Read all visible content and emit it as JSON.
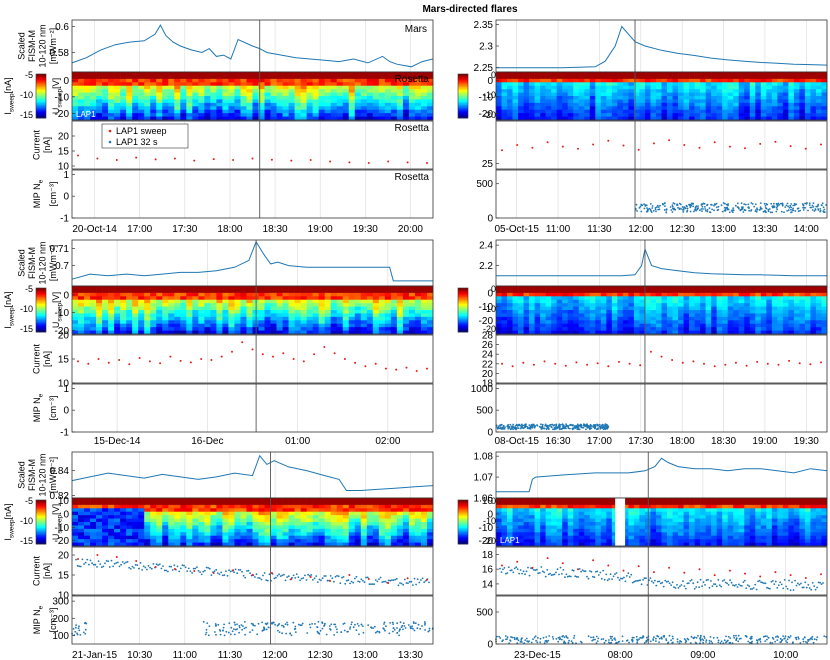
{
  "title": "Mars-directed flares",
  "colors": {
    "line": "#1f77b4",
    "sweep": "#e0201b",
    "lap32": "#1f77b4",
    "grid": "#d9d9d9",
    "flare": "#555555"
  },
  "labels": {
    "fism": [
      "Scaled",
      "FISM-M",
      "10-120 nm",
      "[mWm⁻²]"
    ],
    "isweep": "I",
    "isweep_sub": "sweep",
    "isweep_unit": "[nA]",
    "usweep": "U",
    "usweep_sub": "sweep",
    "usweep_unit": "[V]",
    "current": [
      "Current",
      "[nA]"
    ],
    "mip": [
      "MIP N",
      "[cm⁻³]"
    ],
    "mip_sub": "e"
  },
  "panel_tags": {
    "mars": "Mars",
    "rosetta": "Rosetta",
    "lap1": "LAP1"
  },
  "legend": {
    "sweep": "LAP1 sweep",
    "lap32": "LAP1 32 s"
  },
  "chart_data": [
    {
      "id": "c1",
      "type": "line",
      "flare_time": "17:58",
      "xticks": [
        "20-Oct-14",
        "17:00",
        "17:30",
        "18:00",
        "18:30",
        "19:00",
        "19:30",
        "20:00"
      ],
      "tags": {
        "fism": "mars",
        "spec": "rosetta",
        "spec_lap1": true,
        "cur": "rosetta",
        "mip": "rosetta",
        "legend": true
      },
      "fism": {
        "ylim": [
          0.565,
          0.605
        ],
        "yticks": [
          "0.6",
          "0.58"
        ],
        "ytick_vals": [
          0.6,
          0.58
        ],
        "x": [
          0,
          0.04,
          0.08,
          0.12,
          0.16,
          0.2,
          0.23,
          0.245,
          0.26,
          0.28,
          0.3,
          0.33,
          0.36,
          0.38,
          0.4,
          0.42,
          0.44,
          0.46,
          0.5,
          0.52,
          0.54,
          0.58,
          0.62,
          0.66,
          0.7,
          0.74,
          0.78,
          0.82,
          0.86,
          0.88,
          0.9,
          0.94,
          0.97,
          1
        ],
        "y": [
          0.572,
          0.576,
          0.582,
          0.586,
          0.588,
          0.589,
          0.594,
          0.601,
          0.593,
          0.588,
          0.585,
          0.582,
          0.58,
          0.583,
          0.577,
          0.578,
          0.575,
          0.59,
          0.585,
          0.583,
          0.58,
          0.578,
          0.576,
          0.575,
          0.574,
          0.573,
          0.575,
          0.572,
          0.577,
          0.573,
          0.571,
          0.569,
          0.573,
          0.575
        ]
      },
      "spec": {
        "cbar": false,
        "yticks": [
          "0",
          "-10",
          "-20"
        ],
        "ytick_vals": [
          0,
          -10,
          -20
        ],
        "ylim": [
          -24,
          5
        ],
        "gap": null
      },
      "current": {
        "ylim": [
          9,
          25
        ],
        "yticks": [
          "20",
          "15",
          "10"
        ],
        "ytick_vals": [
          20,
          15,
          10
        ],
        "sweep": [
          13.5,
          12.5,
          12.0,
          12.8,
          12.2,
          12.5,
          11.8,
          12.3,
          12.0,
          12.5,
          12.1,
          11.8,
          12.0,
          11.5,
          11.2,
          11.0,
          11.5,
          11.2,
          11.0
        ],
        "lap32": null
      },
      "mip": {
        "ylim": [
          -1,
          1.2
        ],
        "yticks": [
          "1",
          "0",
          "-1"
        ],
        "ytick_vals": [
          1,
          0,
          -1
        ],
        "points": null
      }
    },
    {
      "id": "c2",
      "type": "line",
      "flare_time": "11:40",
      "xticks": [
        "05-Oct-15",
        "11:00",
        "11:30",
        "12:00",
        "12:30",
        "13:00",
        "13:30",
        "14:00"
      ],
      "tags": {
        "fism": null,
        "spec": null,
        "spec_lap1": false,
        "cur": null,
        "mip": null,
        "legend": false
      },
      "fism": {
        "ylim": [
          2.24,
          2.36
        ],
        "yticks": [
          "2.35",
          "2.3",
          "2.25"
        ],
        "ytick_vals": [
          2.35,
          2.3,
          2.25
        ],
        "x": [
          0,
          0.1,
          0.2,
          0.3,
          0.33,
          0.36,
          0.38,
          0.42,
          0.45,
          0.5,
          0.55,
          0.6,
          0.65,
          0.7,
          0.75,
          0.8,
          0.85,
          0.9,
          0.95,
          1
        ],
        "y": [
          2.25,
          2.25,
          2.25,
          2.252,
          2.265,
          2.3,
          2.345,
          2.31,
          2.3,
          2.29,
          2.283,
          2.278,
          2.272,
          2.268,
          2.265,
          2.262,
          2.26,
          2.258,
          2.257,
          2.256
        ]
      },
      "spec": {
        "cbar": true,
        "yticks": [
          "0",
          "-10",
          "-20"
        ],
        "ytick_vals": [
          0,
          -10,
          -20
        ],
        "ylim": [
          -24,
          5
        ],
        "gap": null
      },
      "current": {
        "ylim": [
          24,
          33
        ],
        "yticks": [
          "25"
        ],
        "ytick_vals": [
          25
        ],
        "sweep": [
          27.5,
          28.5,
          28.0,
          29.0,
          28.2,
          27.8,
          28.6,
          29.3,
          28.4,
          27.6,
          28.8,
          29.4,
          28.5,
          28.0,
          29.0,
          28.2,
          27.9,
          28.7,
          29.1,
          28.3,
          27.8,
          28.6
        ],
        "lap32": null
      },
      "mip": {
        "ylim": [
          0,
          700
        ],
        "yticks": [
          "500",
          "0"
        ],
        "ytick_vals": [
          500,
          0
        ],
        "points": {
          "xstart": 0.42,
          "xend": 1,
          "mean": 150,
          "spread": 70
        }
      }
    },
    {
      "id": "c3",
      "type": "line",
      "flare_time": "00:00",
      "xticks": [
        "15-Dec-14",
        "16-Dec",
        "01:00",
        "02:00"
      ],
      "tags": {
        "fism": null,
        "spec": null,
        "spec_lap1": false,
        "cur": null,
        "mip": null,
        "legend": false
      },
      "fism": {
        "ylim": [
          0.688,
          0.715
        ],
        "yticks": [
          "0.71",
          "0.7"
        ],
        "ytick_vals": [
          0.71,
          0.7
        ],
        "x": [
          0,
          0.05,
          0.1,
          0.15,
          0.2,
          0.25,
          0.3,
          0.35,
          0.4,
          0.45,
          0.49,
          0.51,
          0.53,
          0.55,
          0.57,
          0.6,
          0.65,
          0.7,
          0.75,
          0.8,
          0.85,
          0.88,
          0.89,
          0.95,
          1
        ],
        "y": [
          0.692,
          0.695,
          0.694,
          0.695,
          0.694,
          0.695,
          0.696,
          0.696,
          0.697,
          0.699,
          0.703,
          0.714,
          0.707,
          0.701,
          0.702,
          0.7,
          0.699,
          0.699,
          0.699,
          0.699,
          0.699,
          0.699,
          0.691,
          0.691,
          0.691
        ]
      },
      "spec": {
        "cbar": true,
        "yticks": [
          "0",
          "-10",
          "-20"
        ],
        "ytick_vals": [
          0,
          -10,
          -20
        ],
        "ylim": [
          -22,
          5
        ],
        "gap": null
      },
      "current": {
        "ylim": [
          10,
          20
        ],
        "yticks": [
          "20",
          "15",
          "10"
        ],
        "ytick_vals": [
          20,
          15,
          10
        ],
        "sweep": [
          14.5,
          14.0,
          15.0,
          14.2,
          14.8,
          13.9,
          15.2,
          14.5,
          14.1,
          15.5,
          14.6,
          14.3,
          15.0,
          14.8,
          15.5,
          16.5,
          18.5,
          17.0,
          16.0,
          15.5,
          16.2,
          15.0,
          14.5,
          16.0,
          17.5,
          16.2,
          15.0,
          14.2,
          13.5,
          14.0,
          13.0,
          12.8,
          13.2,
          12.5,
          13.0
        ],
        "lap32": null
      },
      "mip": {
        "ylim": [
          -1,
          1.2
        ],
        "yticks": [
          "1",
          "0",
          "-1"
        ],
        "ytick_vals": [
          1,
          0,
          -1
        ],
        "points": null
      }
    },
    {
      "id": "c4",
      "type": "line",
      "flare_time": "17:20",
      "xticks": [
        "08-Oct-15",
        "16:30",
        "17:00",
        "17:30",
        "18:00",
        "18:30",
        "19:00",
        "19:30"
      ],
      "tags": {
        "fism": null,
        "spec": null,
        "spec_lap1": false,
        "cur": null,
        "mip": null,
        "legend": false
      },
      "fism": {
        "ylim": [
          2.0,
          2.45
        ],
        "yticks": [
          "2.4",
          "2.2"
        ],
        "ytick_vals": [
          2.4,
          2.2
        ],
        "x": [
          0,
          0.1,
          0.2,
          0.3,
          0.38,
          0.42,
          0.44,
          0.45,
          0.47,
          0.5,
          0.55,
          0.6,
          0.65,
          0.7,
          0.75,
          0.8,
          0.85,
          0.9,
          0.95,
          1
        ],
        "y": [
          2.1,
          2.1,
          2.1,
          2.1,
          2.1,
          2.11,
          2.2,
          2.36,
          2.2,
          2.17,
          2.15,
          2.13,
          2.12,
          2.115,
          2.11,
          2.11,
          2.105,
          2.1,
          2.1,
          2.1
        ]
      },
      "spec": {
        "cbar": true,
        "yticks": [
          "0",
          "-10",
          "-20"
        ],
        "ytick_vals": [
          0,
          -10,
          -20
        ],
        "ylim": [
          -30,
          5
        ],
        "gap": null
      },
      "current": {
        "ylim": [
          18,
          28
        ],
        "yticks": [
          "28",
          "26",
          "24",
          "22",
          "20",
          "18"
        ],
        "ytick_vals": [
          28,
          26,
          24,
          22,
          20,
          18
        ],
        "sweep": [
          22.0,
          21.5,
          22.2,
          21.8,
          22.5,
          22.0,
          21.6,
          22.3,
          21.8,
          22.1,
          21.5,
          22.4,
          22.0,
          21.7,
          24.5,
          23.5,
          22.8,
          22.2,
          22.5,
          22.0,
          21.5,
          21.8,
          22.2,
          21.6,
          22.4,
          22.0,
          21.8,
          22.6,
          22.1,
          21.9,
          22.3
        ],
        "lap32": null
      },
      "mip": {
        "ylim": [
          0,
          1100
        ],
        "yticks": [
          "1000",
          "500",
          "0"
        ],
        "ytick_vals": [
          1000,
          500,
          0
        ],
        "points": {
          "xstart": 0,
          "xend": 0.34,
          "mean": 120,
          "spread": 60
        }
      }
    },
    {
      "id": "c5",
      "type": "line",
      "flare_time": "11:35",
      "xticks": [
        "21-Jan-15",
        "10:30",
        "11:00",
        "11:30",
        "12:00",
        "12:30",
        "13:00",
        "13:30"
      ],
      "tags": {
        "fism": null,
        "spec": null,
        "spec_lap1": false,
        "cur": null,
        "mip": null,
        "legend": false
      },
      "fism": {
        "ylim": [
          0.818,
          0.855
        ],
        "yticks": [
          "0.84",
          "0.82"
        ],
        "ytick_vals": [
          0.84,
          0.82
        ],
        "x": [
          0,
          0.05,
          0.1,
          0.15,
          0.2,
          0.25,
          0.3,
          0.35,
          0.4,
          0.45,
          0.5,
          0.52,
          0.54,
          0.56,
          0.6,
          0.65,
          0.7,
          0.74,
          0.76,
          0.8,
          0.85,
          0.9,
          0.95,
          1
        ],
        "y": [
          0.832,
          0.835,
          0.838,
          0.836,
          0.834,
          0.837,
          0.835,
          0.833,
          0.835,
          0.838,
          0.836,
          0.852,
          0.845,
          0.848,
          0.843,
          0.84,
          0.836,
          0.833,
          0.824,
          0.824,
          0.825,
          0.826,
          0.827,
          0.828
        ]
      },
      "spec": {
        "cbar": false,
        "yticks": [
          "10",
          "0",
          "-10",
          "-20"
        ],
        "ytick_vals": [
          10,
          0,
          -10,
          -20
        ],
        "ylim": [
          -24,
          12
        ],
        "gap": null
      },
      "current": {
        "ylim": [
          10,
          22
        ],
        "yticks": [
          "20",
          "15",
          "10"
        ],
        "ytick_vals": [
          20,
          15,
          10
        ],
        "sweep": [
          19.0,
          20.0,
          19.5,
          18.5,
          17.0,
          16.5,
          16.0,
          15.5,
          16.2,
          15.0,
          15.5,
          14.0,
          14.5,
          13.5,
          15.0,
          14.0,
          13.0,
          14.2,
          13.8
        ],
        "lap32": {
          "trend": [
            [
              0,
              18
            ],
            [
              0.15,
              17.5
            ],
            [
              0.3,
              16.5
            ],
            [
              0.45,
              15.5
            ],
            [
              0.55,
              14.5
            ],
            [
              0.7,
              14.0
            ],
            [
              0.85,
              13.5
            ],
            [
              1,
              13.2
            ]
          ],
          "spread": 1.0
        }
      },
      "mip": {
        "ylim": [
          50,
          330
        ],
        "yticks": [
          "300",
          "200",
          "100"
        ],
        "ytick_vals": [
          300,
          200,
          100
        ],
        "points": {
          "xstart": 0,
          "xend": 1,
          "mean": 140,
          "spread": 40,
          "gapstart": 0.04,
          "gapend": 0.36
        }
      }
    },
    {
      "id": "c6",
      "type": "line",
      "flare_time": "08:05",
      "xticks": [
        "23-Dec-15",
        "08:00",
        "09:00",
        "10:00"
      ],
      "tags": {
        "fism": null,
        "spec": null,
        "spec_lap1": true,
        "cur": null,
        "mip": null,
        "legend": false
      },
      "fism": {
        "ylim": [
          1.06,
          1.082
        ],
        "yticks": [
          "1.08",
          "1.07",
          "1.06"
        ],
        "ytick_vals": [
          1.08,
          1.07,
          1.06
        ],
        "x": [
          0,
          0.05,
          0.1,
          0.11,
          0.12,
          0.2,
          0.3,
          0.4,
          0.45,
          0.48,
          0.5,
          0.52,
          0.55,
          0.6,
          0.65,
          0.7,
          0.75,
          0.8,
          0.85,
          0.9,
          0.95,
          1
        ],
        "y": [
          1.063,
          1.063,
          1.063,
          1.069,
          1.07,
          1.071,
          1.072,
          1.072,
          1.073,
          1.075,
          1.079,
          1.077,
          1.075,
          1.074,
          1.074,
          1.073,
          1.074,
          1.074,
          1.073,
          1.072,
          1.074,
          1.073
        ]
      },
      "spec": {
        "cbar": true,
        "yticks": [
          "10",
          "0",
          "-10",
          "-20"
        ],
        "ytick_vals": [
          10,
          0,
          -10,
          -20
        ],
        "ylim": [
          -24,
          12
        ],
        "gap": [
          0.36,
          0.39
        ]
      },
      "current": {
        "ylim": [
          12.5,
          19
        ],
        "yticks": [
          "18",
          "16",
          "14"
        ],
        "ytick_vals": [
          18,
          16,
          14
        ],
        "sweep": [
          16.5,
          17.0,
          16.2,
          17.5,
          16.8,
          16.0,
          17.2,
          16.5,
          15.8,
          16.4,
          15.6,
          16.2,
          15.5,
          16.0,
          15.2,
          15.8,
          15.4,
          15.0,
          15.6,
          15.2,
          14.8,
          15.3
        ],
        "lap32": {
          "trend": [
            [
              0,
              16.0
            ],
            [
              0.2,
              15.5
            ],
            [
              0.38,
              15.0
            ],
            [
              0.45,
              14.2
            ],
            [
              0.6,
              14.0
            ],
            [
              0.8,
              13.8
            ],
            [
              1,
              13.9
            ]
          ],
          "spread": 0.7
        }
      },
      "mip": {
        "ylim": [
          0,
          750
        ],
        "yticks": [
          "500",
          "0"
        ],
        "ytick_vals": [
          500,
          0
        ],
        "points": {
          "xstart": 0,
          "xend": 1,
          "mean": 70,
          "spread": 60
        }
      }
    }
  ]
}
